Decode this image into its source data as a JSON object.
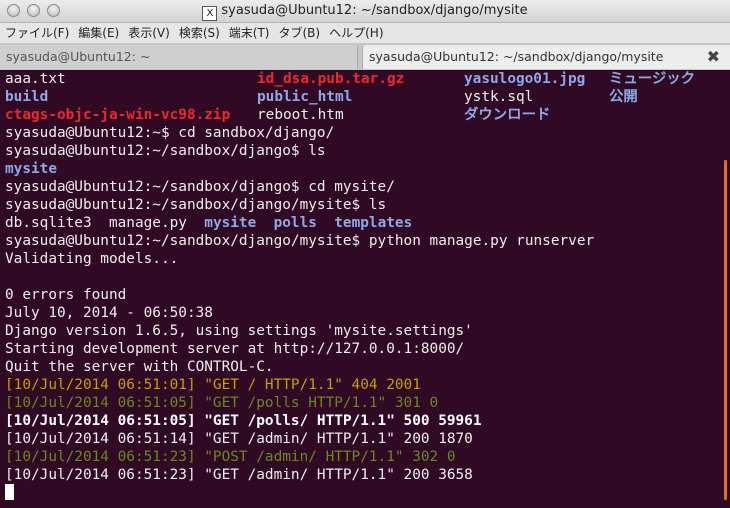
{
  "window": {
    "title": "syasuda@Ubuntu12: ~/sandbox/django/mysite",
    "title_icon_glyph": "X"
  },
  "menu": [
    "ファイル(F)",
    "編集(E)",
    "表示(V)",
    "検索(S)",
    "端末(T)",
    "タブ(B)",
    "ヘルプ(H)"
  ],
  "tabs": [
    {
      "label": "syasuda@Ubuntu12: ~",
      "active": false
    },
    {
      "label": "syasuda@Ubuntu12: ~/sandbox/django/mysite",
      "active": true,
      "close": "✖"
    }
  ],
  "listing": [
    [
      {
        "t": "aaa.txt",
        "c": "grey"
      },
      {
        "t": "id_dsa.pub.tar.gz",
        "c": "red"
      },
      {
        "t": "yasulogo01.jpg",
        "c": "blue"
      },
      {
        "t": "ミュージック",
        "c": "blue"
      }
    ],
    [
      {
        "t": "build",
        "c": "blue"
      },
      {
        "t": "public_html",
        "c": "blue"
      },
      {
        "t": "ystk.sql",
        "c": "grey"
      },
      {
        "t": "公開",
        "c": "blue"
      }
    ],
    [
      {
        "t": "ctags-objc-ja-win-vc98.zip",
        "c": "red"
      },
      {
        "t": "reboot.htm",
        "c": "grey"
      },
      {
        "t": "ダウンロード",
        "c": "blue"
      },
      {
        "t": "",
        "c": "grey"
      }
    ]
  ],
  "lines": [
    {
      "t": "syasuda@Ubuntu12:~$ cd sandbox/django/",
      "c": "grey"
    },
    {
      "t": "syasuda@Ubuntu12:~/sandbox/django$ ls",
      "c": "grey"
    },
    {
      "t": "mysite",
      "c": "blue"
    },
    {
      "t": "syasuda@Ubuntu12:~/sandbox/django$ cd mysite/",
      "c": "grey"
    },
    {
      "t": "syasuda@Ubuntu12:~/sandbox/django/mysite$ ls",
      "c": "grey"
    },
    {
      "parts": [
        {
          "t": "db.sqlite3  manage.py  ",
          "c": "grey"
        },
        {
          "t": "mysite",
          "c": "blue"
        },
        {
          "t": "  ",
          "c": "grey"
        },
        {
          "t": "polls",
          "c": "blue"
        },
        {
          "t": "  ",
          "c": "grey"
        },
        {
          "t": "templates",
          "c": "blue"
        }
      ]
    },
    {
      "t": "syasuda@Ubuntu12:~/sandbox/django/mysite$ python manage.py runserver",
      "c": "grey"
    },
    {
      "t": "Validating models...",
      "c": "grey"
    },
    {
      "t": "",
      "c": "grey"
    },
    {
      "t": "0 errors found",
      "c": "grey"
    },
    {
      "t": "July 10, 2014 - 06:50:38",
      "c": "grey"
    },
    {
      "t": "Django version 1.6.5, using settings 'mysite.settings'",
      "c": "grey"
    },
    {
      "t": "Starting development server at http://127.0.0.1:8000/",
      "c": "grey"
    },
    {
      "t": "Quit the server with CONTROL-C.",
      "c": "grey"
    },
    {
      "t": "[10/Jul/2014 06:51:01] \"GET / HTTP/1.1\" 404 2001",
      "c": "yellow"
    },
    {
      "t": "[10/Jul/2014 06:51:05] \"GET /polls HTTP/1.1\" 301 0",
      "c": "green"
    },
    {
      "t": "[10/Jul/2014 06:51:05] \"GET /polls/ HTTP/1.1\" 500 59961",
      "c": "bold"
    },
    {
      "t": "[10/Jul/2014 06:51:14] \"GET /admin/ HTTP/1.1\" 200 1870",
      "c": "grey"
    },
    {
      "t": "[10/Jul/2014 06:51:23] \"POST /admin/ HTTP/1.1\" 302 0",
      "c": "green"
    },
    {
      "t": "[10/Jul/2014 06:51:23] \"GET /admin/ HTTP/1.1\" 200 3658",
      "c": "grey"
    }
  ],
  "colors": {
    "background": "#300a24",
    "foreground": "#eeeeec",
    "directory": "#8ea9e6",
    "archive": "#ef2929",
    "scroll_thumb": "#e07020"
  }
}
